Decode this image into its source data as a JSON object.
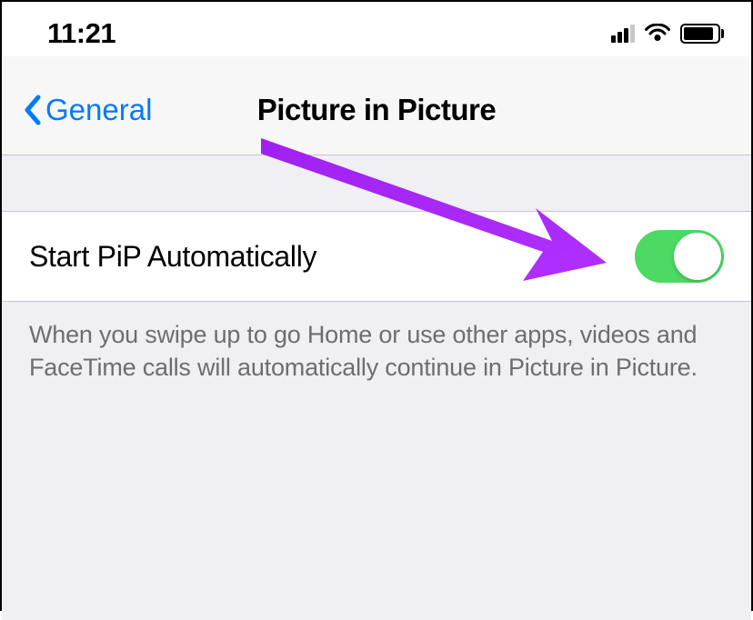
{
  "statusBar": {
    "time": "11:21"
  },
  "navigation": {
    "backLabel": "General",
    "title": "Picture in Picture"
  },
  "setting": {
    "label": "Start PiP Automatically",
    "enabled": true,
    "description": "When you swipe up to go Home or use other apps, videos and FaceTime calls will automatically continue in Picture in Picture."
  }
}
